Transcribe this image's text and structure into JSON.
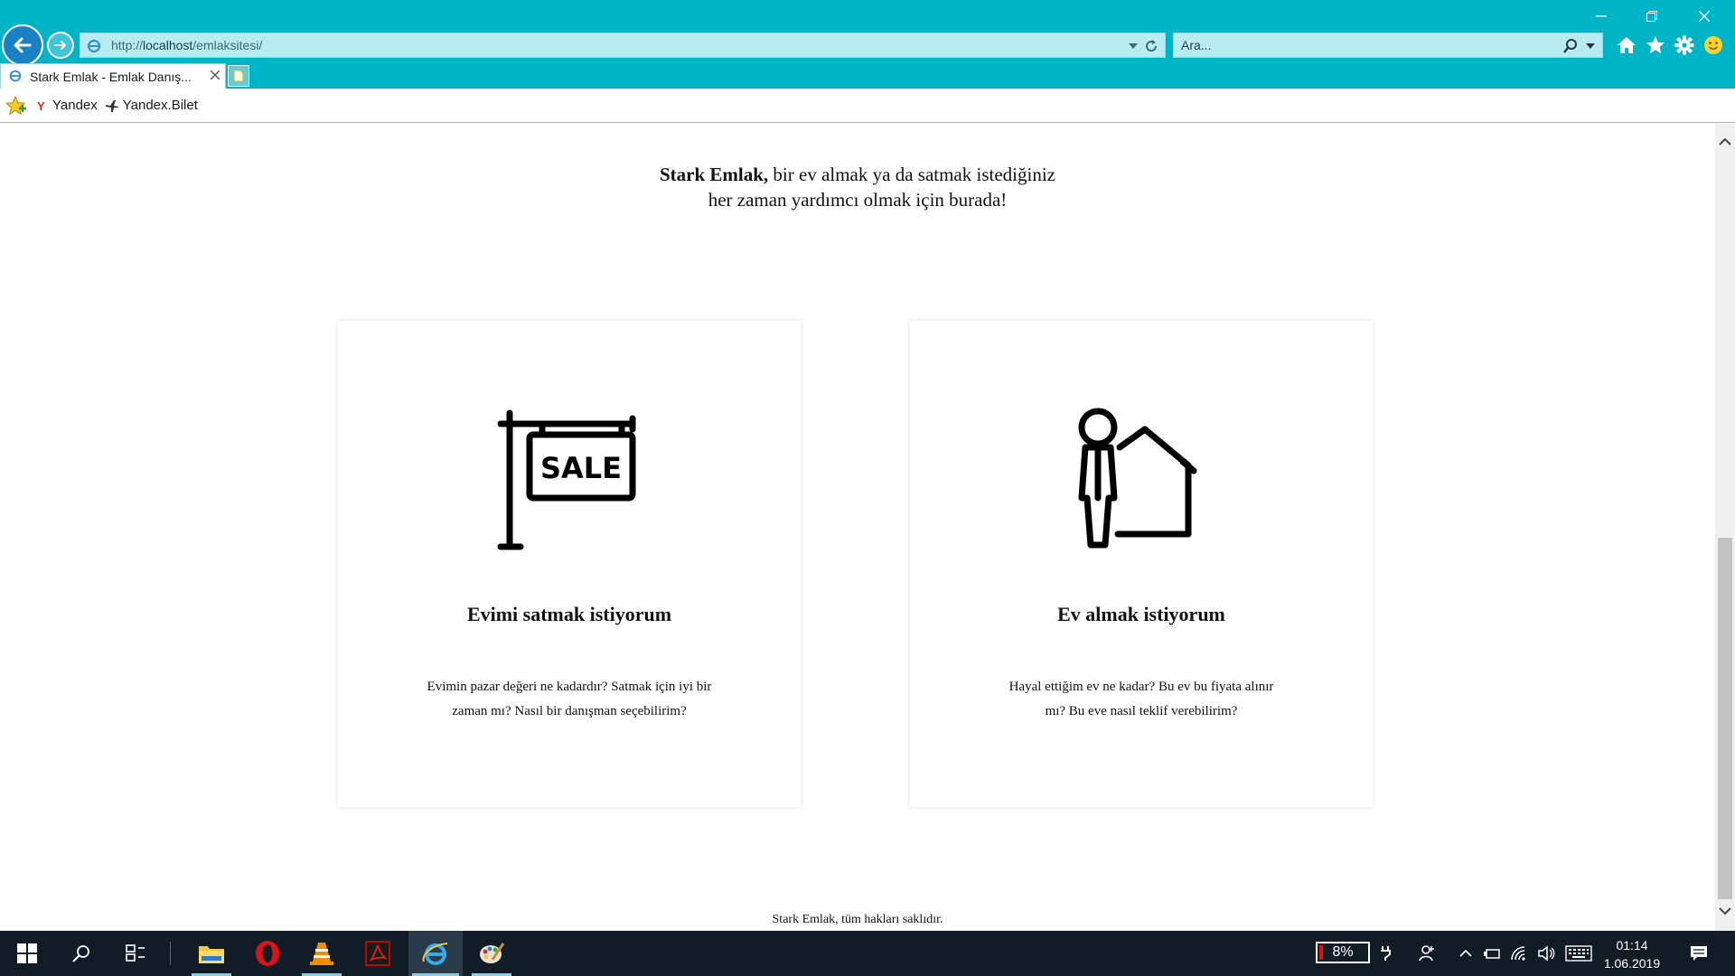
{
  "browser": {
    "url_prefix": "http://",
    "url_host": "localhost",
    "url_path": "/emlaksitesi/",
    "search_placeholder": "Ara...",
    "tab_title": "Stark Emlak - Emlak Danış...",
    "favorites": [
      {
        "label": "Yandex",
        "icon": "yandex-icon"
      },
      {
        "label": "Yandex.Bilet",
        "icon": "plane-icon"
      }
    ],
    "accent_color": "#00b4c8"
  },
  "page": {
    "tagline_brand": "Stark Emlak,",
    "tagline_line1_rest": " bir ev almak ya da satmak istediğiniz",
    "tagline_line2": "her zaman yardımcı olmak için burada!",
    "cards": [
      {
        "icon": "for-sale-sign-icon",
        "sign_text": "SALE",
        "title": "Evimi satmak istiyorum",
        "text_line1": "Evimin pazar değeri ne kadardır? Satmak için iyi bir",
        "text_line2": "zaman mı? Nasıl bir danışman seçebilirim?"
      },
      {
        "icon": "person-house-icon",
        "title": "Ev almak istiyorum",
        "text_line1": "Hayal ettiğim ev ne kadar? Bu ev bu fiyata alınır",
        "text_line2": "mı? Bu eve nasıl teklif verebilirim?"
      }
    ],
    "footer": "Stark Emlak, tüm hakları saklıdır."
  },
  "taskbar": {
    "battery_percent": "8%",
    "battery_level": 0.08,
    "time": "01:14",
    "date": "1.06.2019",
    "pinned_apps": [
      "file-explorer-icon",
      "opera-icon",
      "vlc-icon",
      "acrobat-icon",
      "internet-explorer-icon",
      "paint-icon"
    ]
  }
}
